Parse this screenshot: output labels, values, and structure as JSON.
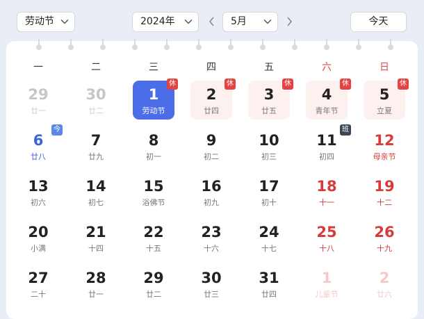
{
  "toolbar": {
    "holiday_select": "劳动节",
    "year_select": "2024年",
    "month_select": "5月",
    "today_button": "今天"
  },
  "weekdays": [
    "一",
    "二",
    "三",
    "四",
    "五",
    "六",
    "日"
  ],
  "weeks": [
    [
      {
        "day": "29",
        "sub": "廿一",
        "state": "dim"
      },
      {
        "day": "30",
        "sub": "廿二",
        "state": "dim"
      },
      {
        "day": "1",
        "sub": "劳动节",
        "state": "today",
        "badge": "休"
      },
      {
        "day": "2",
        "sub": "廿四",
        "state": "holiday",
        "badge": "休"
      },
      {
        "day": "3",
        "sub": "廿五",
        "state": "holiday",
        "badge": "休"
      },
      {
        "day": "4",
        "sub": "青年节",
        "state": "holiday",
        "badge": "休"
      },
      {
        "day": "5",
        "sub": "立夏",
        "state": "holiday",
        "badge": "休"
      }
    ],
    [
      {
        "day": "6",
        "sub": "廿八",
        "state": "blue",
        "badge": "今",
        "badge_style": "blue"
      },
      {
        "day": "7",
        "sub": "廿九",
        "state": "normal"
      },
      {
        "day": "8",
        "sub": "初一",
        "state": "normal"
      },
      {
        "day": "9",
        "sub": "初二",
        "state": "normal"
      },
      {
        "day": "10",
        "sub": "初三",
        "state": "normal"
      },
      {
        "day": "11",
        "sub": "初四",
        "state": "normal",
        "badge": "班",
        "badge_style": "dark"
      },
      {
        "day": "12",
        "sub": "母亲节",
        "state": "red"
      }
    ],
    [
      {
        "day": "13",
        "sub": "初六",
        "state": "normal"
      },
      {
        "day": "14",
        "sub": "初七",
        "state": "normal"
      },
      {
        "day": "15",
        "sub": "浴佛节",
        "state": "normal"
      },
      {
        "day": "16",
        "sub": "初九",
        "state": "normal"
      },
      {
        "day": "17",
        "sub": "初十",
        "state": "normal"
      },
      {
        "day": "18",
        "sub": "十一",
        "state": "red"
      },
      {
        "day": "19",
        "sub": "十二",
        "state": "red"
      }
    ],
    [
      {
        "day": "20",
        "sub": "小满",
        "state": "normal"
      },
      {
        "day": "21",
        "sub": "十四",
        "state": "normal"
      },
      {
        "day": "22",
        "sub": "十五",
        "state": "normal"
      },
      {
        "day": "23",
        "sub": "十六",
        "state": "normal"
      },
      {
        "day": "24",
        "sub": "十七",
        "state": "normal"
      },
      {
        "day": "25",
        "sub": "十八",
        "state": "red"
      },
      {
        "day": "26",
        "sub": "十九",
        "state": "red"
      }
    ],
    [
      {
        "day": "27",
        "sub": "二十",
        "state": "normal"
      },
      {
        "day": "28",
        "sub": "廿一",
        "state": "normal"
      },
      {
        "day": "29",
        "sub": "廿二",
        "state": "normal"
      },
      {
        "day": "30",
        "sub": "廿三",
        "state": "normal"
      },
      {
        "day": "31",
        "sub": "廿四",
        "state": "normal"
      },
      {
        "day": "1",
        "sub": "儿童节",
        "state": "dimred"
      },
      {
        "day": "2",
        "sub": "廿六",
        "state": "dimred"
      }
    ]
  ]
}
